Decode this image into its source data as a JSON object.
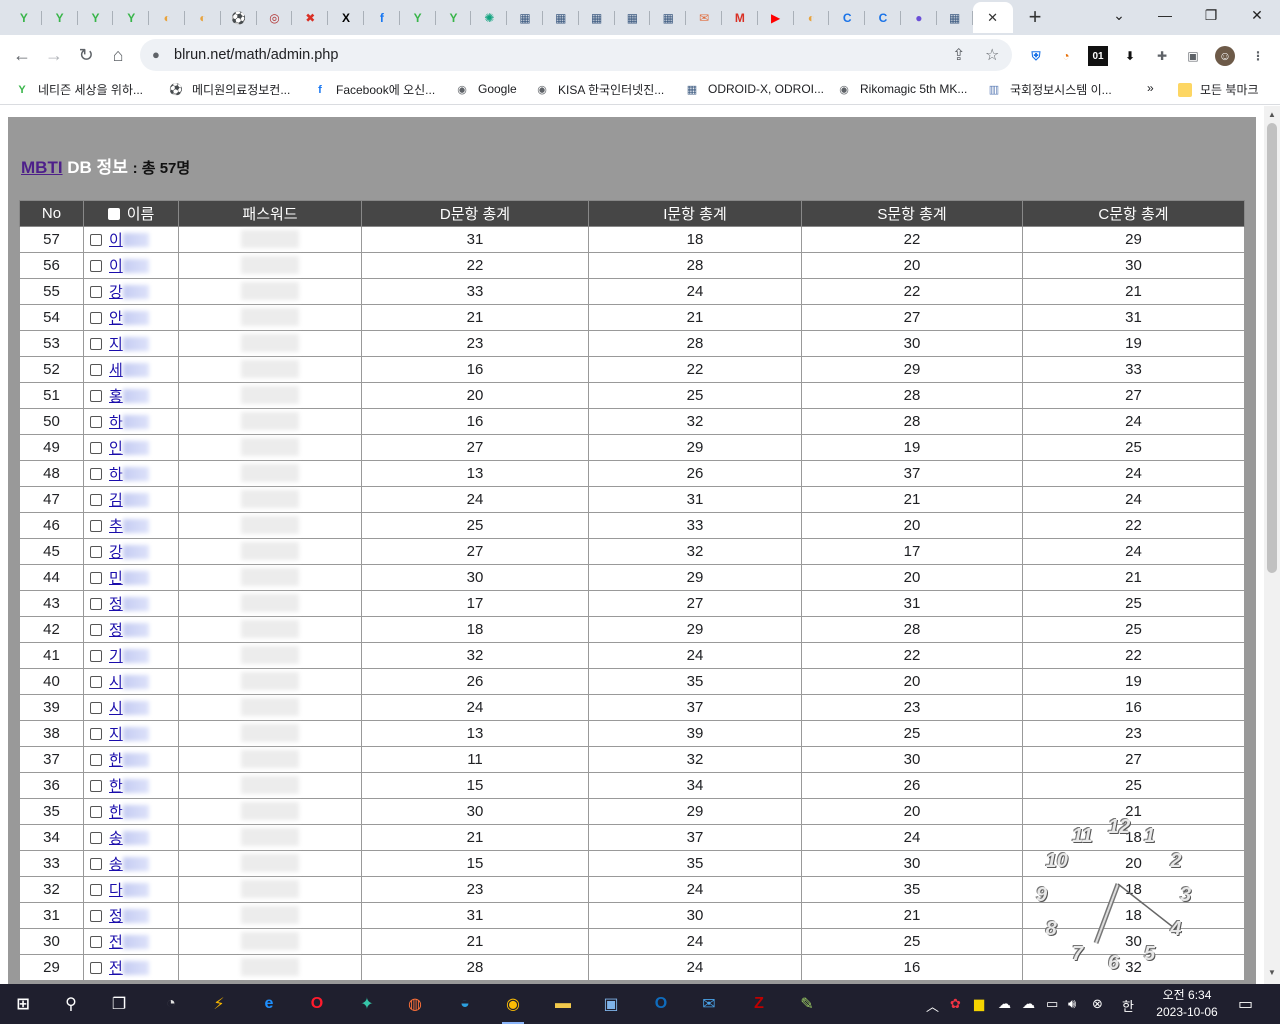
{
  "browser": {
    "tabs": [
      {
        "icon": "naver-cafe-icon",
        "glyph": "Y",
        "color": "#39b54a"
      },
      {
        "icon": "naver-cafe-icon",
        "glyph": "Y",
        "color": "#39b54a"
      },
      {
        "icon": "naver-cafe-icon",
        "glyph": "Y",
        "color": "#39b54a"
      },
      {
        "icon": "naver-cafe-icon",
        "glyph": "Y",
        "color": "#39b54a"
      },
      {
        "icon": "blog-icon",
        "glyph": "◐",
        "color": "#e8a33d"
      },
      {
        "icon": "blog-icon",
        "glyph": "◐",
        "color": "#e8a33d"
      },
      {
        "icon": "soccer-icon",
        "glyph": "⚽",
        "color": "#333333"
      },
      {
        "icon": "emblem-icon",
        "glyph": "◎",
        "color": "#b03030"
      },
      {
        "icon": "puzzle-site-icon",
        "glyph": "✖",
        "color": "#d93025"
      },
      {
        "icon": "x-icon",
        "glyph": "X",
        "color": "#000000"
      },
      {
        "icon": "facebook-icon",
        "glyph": "f",
        "color": "#1877f2"
      },
      {
        "icon": "naver-cafe-icon",
        "glyph": "Y",
        "color": "#39b54a"
      },
      {
        "icon": "naver-cafe-icon",
        "glyph": "Y",
        "color": "#39b54a"
      },
      {
        "icon": "chatgpt-icon",
        "glyph": "✺",
        "color": "#10a37f"
      },
      {
        "icon": "building-icon",
        "glyph": "▦",
        "color": "#3c5a80"
      },
      {
        "icon": "building-icon",
        "glyph": "▦",
        "color": "#3c5a80"
      },
      {
        "icon": "building-icon",
        "glyph": "▦",
        "color": "#3c5a80"
      },
      {
        "icon": "building-icon",
        "glyph": "▦",
        "color": "#3c5a80"
      },
      {
        "icon": "building-icon",
        "glyph": "▦",
        "color": "#3c5a80"
      },
      {
        "icon": "mail-icon",
        "glyph": "✉",
        "color": "#e06c3c"
      },
      {
        "icon": "gmail-icon",
        "glyph": "M",
        "color": "#d93025"
      },
      {
        "icon": "youtube-icon",
        "glyph": "▶",
        "color": "#ff0000"
      },
      {
        "icon": "blog-icon",
        "glyph": "◐",
        "color": "#e8a33d"
      },
      {
        "icon": "c-icon",
        "glyph": "C",
        "color": "#1a73e8"
      },
      {
        "icon": "c-icon",
        "glyph": "C",
        "color": "#1a73e8"
      },
      {
        "icon": "copilot-icon",
        "glyph": "●",
        "color": "#6b4fd8"
      },
      {
        "icon": "building-icon",
        "glyph": "▦",
        "color": "#3c5a80"
      }
    ],
    "active_tab_close": "✕",
    "new_tab": "+",
    "url": "blrun.net/math/admin.php",
    "bookmarks": [
      {
        "label": "네티즌 세상을 위하...",
        "icon": "naver-cafe-icon",
        "glyph": "Y",
        "color": "#39b54a"
      },
      {
        "label": "메디원의료정보컨...",
        "icon": "soccer-icon",
        "glyph": "⚽",
        "color": "#333333"
      },
      {
        "label": "Facebook에 오신...",
        "icon": "facebook-icon",
        "glyph": "f",
        "color": "#1877f2"
      },
      {
        "label": "Google",
        "icon": "globe-icon",
        "glyph": "◉",
        "color": "#5f6368"
      },
      {
        "label": "KISA 한국인터넷진...",
        "icon": "globe-icon",
        "glyph": "◉",
        "color": "#5f6368"
      },
      {
        "label": "ODROID-X, ODROI...",
        "icon": "building-icon",
        "glyph": "▦",
        "color": "#3c5a80"
      },
      {
        "label": "Rikomagic 5th MK...",
        "icon": "globe-icon",
        "glyph": "◉",
        "color": "#5f6368"
      },
      {
        "label": "국회정보시스템 이...",
        "icon": "assembly-icon",
        "glyph": "▥",
        "color": "#5a7bb5"
      }
    ],
    "bookmarks_overflow": "»",
    "all_bookmarks": "모든 북마크"
  },
  "page": {
    "heading_link": "MBTI",
    "heading_text": "DB 정보",
    "heading_total": ": 총 57명",
    "columns": [
      "No",
      "이름",
      "패스워드",
      "D문항 총계",
      "I문항 총계",
      "S문항 총계",
      "C문항 총계"
    ],
    "rows": [
      {
        "no": "57",
        "name": "이",
        "d": "31",
        "i": "18",
        "s": "22",
        "c": "29"
      },
      {
        "no": "56",
        "name": "이",
        "d": "22",
        "i": "28",
        "s": "20",
        "c": "30"
      },
      {
        "no": "55",
        "name": "강",
        "d": "33",
        "i": "24",
        "s": "22",
        "c": "21"
      },
      {
        "no": "54",
        "name": "안",
        "d": "21",
        "i": "21",
        "s": "27",
        "c": "31"
      },
      {
        "no": "53",
        "name": "지",
        "d": "23",
        "i": "28",
        "s": "30",
        "c": "19"
      },
      {
        "no": "52",
        "name": "세",
        "d": "16",
        "i": "22",
        "s": "29",
        "c": "33"
      },
      {
        "no": "51",
        "name": "홍",
        "d": "20",
        "i": "25",
        "s": "28",
        "c": "27"
      },
      {
        "no": "50",
        "name": "하",
        "d": "16",
        "i": "32",
        "s": "28",
        "c": "24"
      },
      {
        "no": "49",
        "name": "인",
        "d": "27",
        "i": "29",
        "s": "19",
        "c": "25"
      },
      {
        "no": "48",
        "name": "하",
        "d": "13",
        "i": "26",
        "s": "37",
        "c": "24"
      },
      {
        "no": "47",
        "name": "김",
        "d": "24",
        "i": "31",
        "s": "21",
        "c": "24"
      },
      {
        "no": "46",
        "name": "추",
        "d": "25",
        "i": "33",
        "s": "20",
        "c": "22"
      },
      {
        "no": "45",
        "name": "강",
        "d": "27",
        "i": "32",
        "s": "17",
        "c": "24"
      },
      {
        "no": "44",
        "name": "민",
        "d": "30",
        "i": "29",
        "s": "20",
        "c": "21"
      },
      {
        "no": "43",
        "name": "정",
        "d": "17",
        "i": "27",
        "s": "31",
        "c": "25"
      },
      {
        "no": "42",
        "name": "정",
        "d": "18",
        "i": "29",
        "s": "28",
        "c": "25"
      },
      {
        "no": "41",
        "name": "기",
        "d": "32",
        "i": "24",
        "s": "22",
        "c": "22"
      },
      {
        "no": "40",
        "name": "시",
        "d": "26",
        "i": "35",
        "s": "20",
        "c": "19"
      },
      {
        "no": "39",
        "name": "시",
        "d": "24",
        "i": "37",
        "s": "23",
        "c": "16"
      },
      {
        "no": "38",
        "name": "지",
        "d": "13",
        "i": "39",
        "s": "25",
        "c": "23"
      },
      {
        "no": "37",
        "name": "한",
        "d": "11",
        "i": "32",
        "s": "30",
        "c": "27"
      },
      {
        "no": "36",
        "name": "한",
        "d": "15",
        "i": "34",
        "s": "26",
        "c": "25"
      },
      {
        "no": "35",
        "name": "한",
        "d": "30",
        "i": "29",
        "s": "20",
        "c": "21"
      },
      {
        "no": "34",
        "name": "송",
        "d": "21",
        "i": "37",
        "s": "24",
        "c": "18"
      },
      {
        "no": "33",
        "name": "송",
        "d": "15",
        "i": "35",
        "s": "30",
        "c": "20"
      },
      {
        "no": "32",
        "name": "다",
        "d": "23",
        "i": "24",
        "s": "35",
        "c": "18"
      },
      {
        "no": "31",
        "name": "정",
        "d": "31",
        "i": "30",
        "s": "21",
        "c": "18"
      },
      {
        "no": "30",
        "name": "전",
        "d": "21",
        "i": "24",
        "s": "25",
        "c": "30"
      },
      {
        "no": "29",
        "name": "전",
        "d": "28",
        "i": "24",
        "s": "16",
        "c": "32"
      }
    ]
  },
  "clock": {
    "numerals": [
      "12",
      "1",
      "2",
      "3",
      "4",
      "5",
      "6",
      "7",
      "8",
      "9",
      "10",
      "11"
    ]
  },
  "taskbar": {
    "apps": [
      {
        "icon": "windows-start-icon",
        "glyph": "⊞",
        "color": "#ffffff"
      },
      {
        "icon": "search-icon",
        "glyph": "⚲",
        "color": "#ffffff"
      },
      {
        "icon": "task-view-icon",
        "glyph": "❐",
        "color": "#ffffff"
      },
      {
        "icon": "disk-app-icon",
        "glyph": "◔",
        "color": "#e0e0e0"
      },
      {
        "icon": "lightning-app-icon",
        "glyph": "⚡",
        "color": "#f4b400"
      },
      {
        "icon": "internet-explorer-icon",
        "glyph": "e",
        "color": "#1e90ff"
      },
      {
        "icon": "opera-icon",
        "glyph": "O",
        "color": "#ff1b2d"
      },
      {
        "icon": "feather-app-icon",
        "glyph": "✦",
        "color": "#36c5a8"
      },
      {
        "icon": "firefox-icon",
        "glyph": "◍",
        "color": "#ff7139"
      },
      {
        "icon": "edge-icon",
        "glyph": "◒",
        "color": "#2ba0e0"
      },
      {
        "icon": "chrome-icon",
        "glyph": "◉",
        "color": "#fbbc05"
      },
      {
        "icon": "file-explorer-icon",
        "glyph": "▬",
        "color": "#f2c94c"
      },
      {
        "icon": "store-icon",
        "glyph": "▣",
        "color": "#7fb3e8"
      },
      {
        "icon": "outlook-icon",
        "glyph": "O",
        "color": "#0f6cbd"
      },
      {
        "icon": "mail-app-icon",
        "glyph": "✉",
        "color": "#4aa3e8"
      },
      {
        "icon": "filezilla-icon",
        "glyph": "Z",
        "color": "#bf0000"
      },
      {
        "icon": "notepad-icon",
        "glyph": "✎",
        "color": "#9ccc65"
      }
    ],
    "ime": "한",
    "time": "오전 6:34",
    "date": "2023-10-06"
  }
}
